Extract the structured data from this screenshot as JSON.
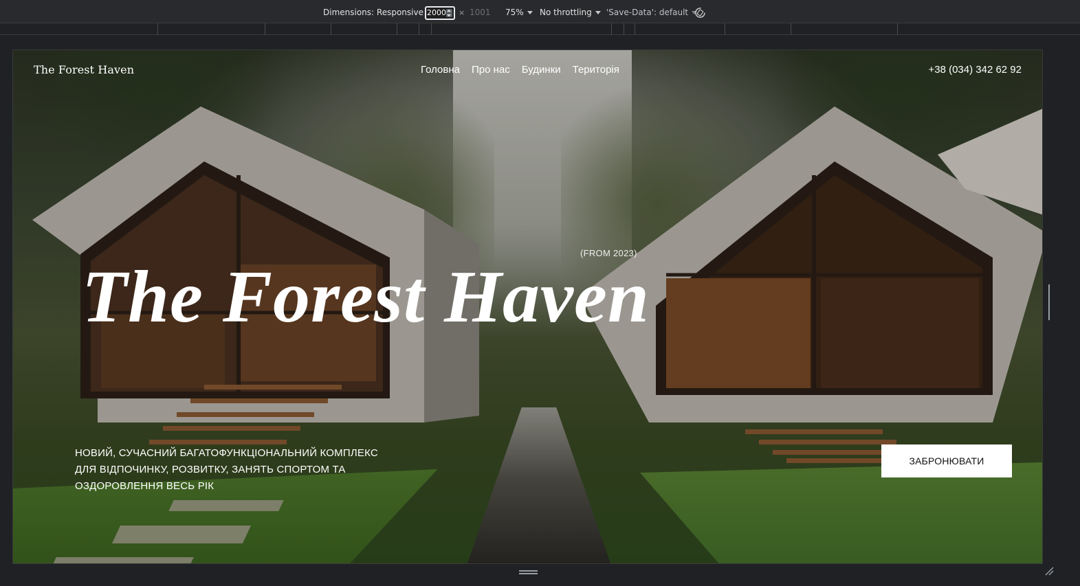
{
  "devtools": {
    "dimensions_label": "Dimensions: Responsive",
    "width_value": "2000",
    "separator": "×",
    "height_value": "1001",
    "zoom": "75%",
    "throttling": "No throttling",
    "save_data": "'Save-Data': default"
  },
  "site": {
    "logo": "The Forest Haven",
    "nav": [
      "Головна",
      "Про нас",
      "Будинки",
      "Територія"
    ],
    "phone": "+38 (034) 342 62 92",
    "since": "(FROM 2023)",
    "title": "The Forest Haven",
    "tagline_lines": [
      "НОВИЙ, СУЧАСНИЙ БАГАТОФУНКЦІОНАЛЬНИЙ КОМПЛЕКС",
      "ДЛЯ ВІДПОЧИНКУ, РОЗВИТКУ, ЗАНЯТЬ СПОРТОМ ТА",
      "ОЗДОРОВЛЕННЯ ВЕСЬ РІК"
    ],
    "book_button": "ЗАБРОНЮВАТИ"
  },
  "icons": {
    "rotate": "rotate-icon",
    "resize": "resize-handle-icon"
  }
}
